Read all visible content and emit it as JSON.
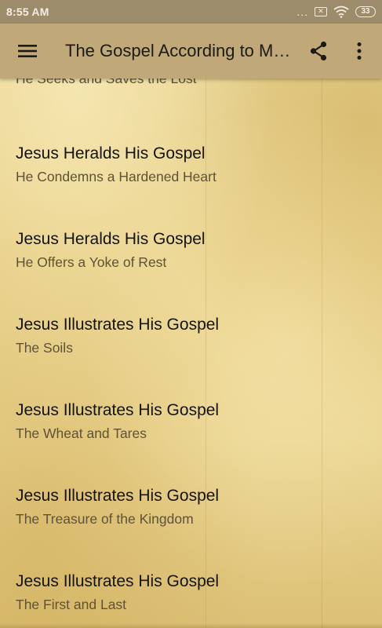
{
  "status_bar": {
    "time": "8:55 AM",
    "dots": "...",
    "battery": "33"
  },
  "app_bar": {
    "title": "The Gospel According to Matthew"
  },
  "list": {
    "items": [
      {
        "title": "",
        "subtitle": "He Seeks and Saves the Lost"
      },
      {
        "title": "Jesus Heralds His Gospel",
        "subtitle": "He Condemns a Hardened Heart"
      },
      {
        "title": "Jesus Heralds His Gospel",
        "subtitle": "He Offers a Yoke of Rest"
      },
      {
        "title": "Jesus Illustrates His Gospel",
        "subtitle": "The Soils"
      },
      {
        "title": "Jesus Illustrates His Gospel",
        "subtitle": "The Wheat and Tares"
      },
      {
        "title": "Jesus Illustrates His Gospel",
        "subtitle": "The Treasure of the Kingdom"
      },
      {
        "title": "Jesus Illustrates His Gospel",
        "subtitle": "The First and Last"
      }
    ]
  },
  "icons": {
    "menu": "hamburger-menu-icon",
    "share": "share-icon",
    "more": "more-vertical-icon",
    "wifi": "wifi-icon",
    "battery": "battery-icon",
    "no-sim": "no-sim-icon"
  },
  "colors": {
    "app_bar": "#c1a878",
    "status_bar": "#9c8c6b",
    "background": "#e8d28a",
    "title_text": "#151310",
    "subtitle_text": "#5f5235"
  }
}
